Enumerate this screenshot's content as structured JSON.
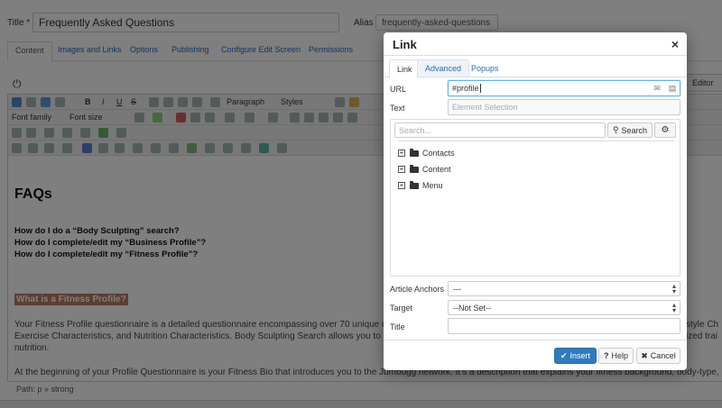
{
  "page": {
    "title_label": "Title *",
    "title_value": "Frequently Asked Questions",
    "alias_label": "Alias",
    "alias_value": "frequently-asked-questions",
    "tabs": [
      "Content",
      "Images and Links",
      "Options",
      "Publishing",
      "Configure Edit Screen",
      "Permissions"
    ],
    "toggle_editor_label": "Editor",
    "toolbar": {
      "format_select": "Paragraph",
      "styles_select": "Styles",
      "font_family_select": "Font family",
      "font_size_select": "Font size"
    },
    "content": {
      "heading": "FAQs",
      "questions": [
        "How do I do a “Body Sculpting” search?",
        "How do I complete/edit my “Business Profile”?",
        "How do I complete/edit my “Fitness Profile”?"
      ],
      "highlight": "What is a Fitness Profile?",
      "paragraph_lines": [
        "Your Fitness Profile questionnaire is a detailed questionnaire encompassing over 70 unique q",
        "Exercise Characteristics, and Nutrition Characteristics. Body Sculpting Search allows you to p",
        "nutrition."
      ],
      "paragraph_tail_1": "style Ch",
      "paragraph_tail_2": "ized trai",
      "paragraph2": "At the beginning of your Profile Questionnaire is your Fitness Bio that introduces you to the Jumbugg network. It's a description that explains your fitness background, body-type,"
    },
    "path": "Path: p » strong"
  },
  "modal": {
    "title": "Link",
    "close": "×",
    "tabs": [
      "Link",
      "Advanced",
      "Popups"
    ],
    "url_label": "URL",
    "url_value": "#profile",
    "text_label": "Text",
    "text_placeholder": "Element Selection",
    "search_placeholder": "Search...",
    "search_button": "Search",
    "tree": [
      "Contacts",
      "Content",
      "Menu"
    ],
    "anchors_label": "Article Anchors",
    "anchors_value": "---",
    "target_label": "Target",
    "target_value": "--Not Set--",
    "title_label": "Title",
    "title_value": "",
    "insert_button": "Insert",
    "help_button": "Help",
    "cancel_button": "Cancel"
  },
  "colors": {
    "primary": "#2f7bbf",
    "overlay": "rgba(0,0,0,0.5)",
    "highlight_bg": "#b97a66"
  }
}
